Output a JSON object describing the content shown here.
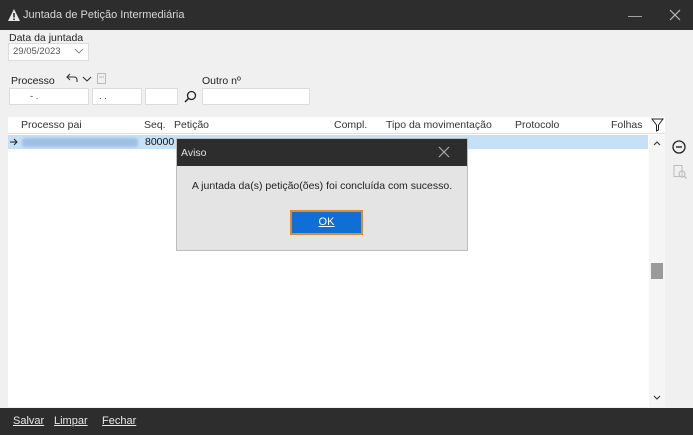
{
  "window": {
    "title": "Juntada de Petição Intermediária"
  },
  "form": {
    "date_label": "Data da juntada",
    "date_value": "29/05/2023",
    "processo_label": "Processo",
    "processo_part1": "- .",
    "processo_part2": ". .",
    "outro_label": "Outro nº"
  },
  "grid": {
    "columns": [
      "Processo pai",
      "Seq.",
      "Petição",
      "Compl.",
      "Tipo da movimentação",
      "Protocolo",
      "Folhas"
    ],
    "rows": [
      {
        "seq": "80000"
      }
    ]
  },
  "footer": {
    "save": "Salvar",
    "clear": "Limpar",
    "close": "Fechar"
  },
  "dialog": {
    "title": "Aviso",
    "message": "A juntada da(s) petição(ões) foi concluída com sucesso.",
    "ok_label": "OK"
  },
  "colors": {
    "accent": "#0f6fd6",
    "focus_border": "#e08a2c",
    "selection": "#c6e0f5"
  }
}
